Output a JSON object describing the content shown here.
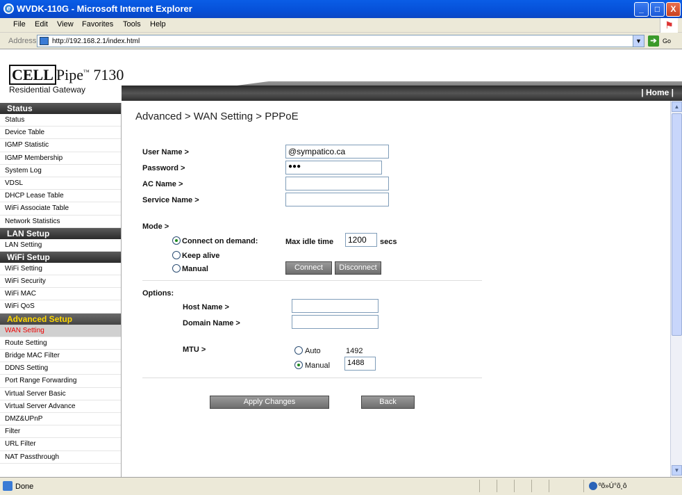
{
  "window": {
    "title": "WVDK-110G - Microsoft Internet Explorer",
    "min": "_",
    "max": "□",
    "close": "X"
  },
  "menu": [
    "File",
    "Edit",
    "View",
    "Favorites",
    "Tools",
    "Help"
  ],
  "address": {
    "label": "Address",
    "url": "http://192.168.2.1/index.html",
    "go": "Go"
  },
  "header": {
    "brand_cell": "CELL",
    "brand_pipe": "Pipe",
    "brand_tm": "™",
    "brand_model": " 7130",
    "subtitle": "Residential Gateway",
    "home": "| Home |"
  },
  "sidebar": {
    "sections": [
      {
        "title": "Status",
        "items": [
          "Status",
          "Device Table",
          "IGMP Statistic",
          "IGMP Membership",
          "System Log",
          "VDSL",
          "DHCP Lease Table",
          "WiFi Associate Table",
          "Network Statistics"
        ]
      },
      {
        "title": "LAN Setup",
        "items": [
          "LAN Setting"
        ]
      },
      {
        "title": "WiFi Setup",
        "items": [
          "WiFi Setting",
          "WiFi Security",
          "WiFi MAC",
          "WiFi QoS"
        ]
      },
      {
        "title": "Advanced Setup",
        "items": [
          "WAN Setting",
          "Route Setting",
          "Bridge MAC Filter",
          "DDNS Setting",
          "Port Range Forwarding",
          "Virtual Server Basic",
          "Virtual Server Advance",
          "DMZ&UPnP",
          "Filter",
          "URL Filter",
          "NAT Passthrough"
        ]
      }
    ],
    "active": "WAN Setting"
  },
  "main": {
    "breadcrumb": "Advanced > WAN Setting > PPPoE",
    "user_name_label": "User Name >",
    "user_name_value": "@sympatico.ca",
    "password_label": "Password >",
    "password_value": "●●●",
    "ac_name_label": "AC Name >",
    "ac_name_value": "",
    "service_name_label": "Service Name >",
    "service_name_value": "",
    "mode_label": "Mode >",
    "mode_connect_on_demand": "Connect on demand:",
    "mode_keep_alive": "Keep alive",
    "mode_manual": "Manual",
    "mode_selected": "Connect on demand",
    "max_idle_label": "Max idle time",
    "max_idle_value": "1200",
    "secs": "secs",
    "connect_btn": "Connect",
    "disconnect_btn": "Disconnect",
    "options_label": "Options:",
    "host_name_label": "Host Name >",
    "host_name_value": "",
    "domain_name_label": "Domain Name >",
    "domain_name_value": "",
    "mtu_label": "MTU >",
    "mtu_auto": "Auto",
    "mtu_auto_value": "1492",
    "mtu_manual": "Manual",
    "mtu_manual_value": "1488",
    "mtu_selected": "Manual",
    "apply_btn": "Apply Changes",
    "back_btn": "Back"
  },
  "status": {
    "text": "Done",
    "zone": "ºõ»Ú°õ¸ô"
  }
}
